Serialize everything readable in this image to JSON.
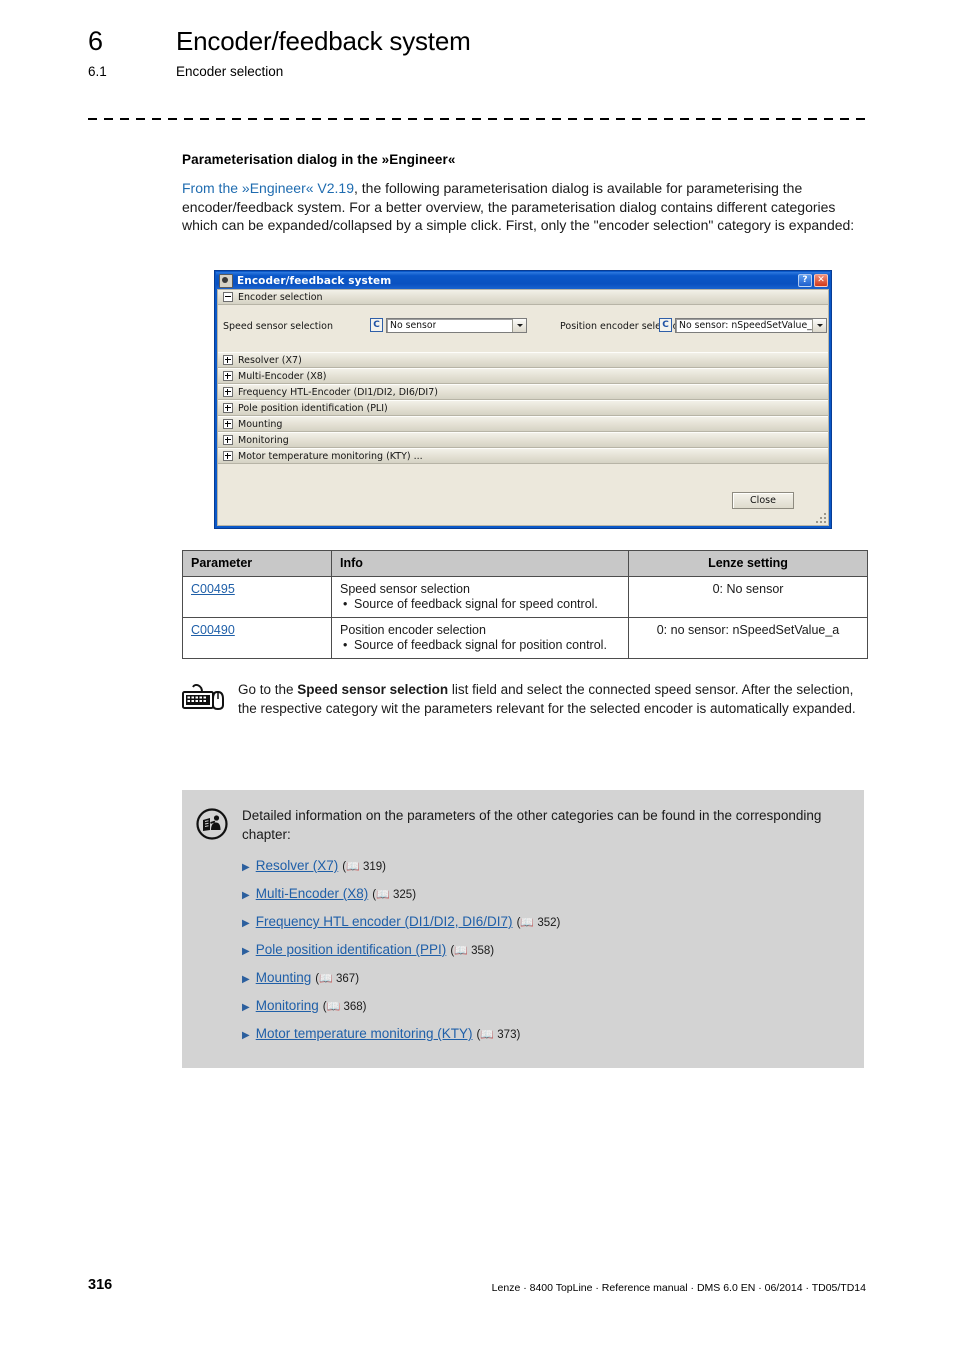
{
  "header": {
    "chapter_number": "6",
    "chapter_title": "Encoder/feedback system",
    "section_number": "6.1",
    "section_title": "Encoder selection"
  },
  "content": {
    "lead_title": "Parameterisation dialog in the »Engineer«",
    "intro_link": "From the »Engineer« V2.19",
    "intro_rest": ", the following parameterisation dialog is available for parameterising the encoder/feedback system. For a better overview, the parameterisation dialog contains different categories which can be expanded/collapsed by a simple click. First, only the \"encoder selection\" category is expanded:"
  },
  "dialog": {
    "title": "Encoder/feedback system",
    "app_icon": "app-icon",
    "help_button": "?",
    "close_button": "✕",
    "expanded_category": "Encoder selection",
    "speed_label": "Speed sensor selection",
    "speed_chip": "C",
    "speed_value": "No sensor",
    "position_label": "Position encoder selection",
    "position_chip": "C",
    "position_value": "No sensor: nSpeedSetValue_a",
    "categories": [
      "Resolver (X7)",
      "Multi-Encoder (X8)",
      "Frequency HTL-Encoder (DI1/DI2, DI6/DI7)",
      "Pole position identification (PLI)",
      "Mounting",
      "Monitoring",
      "Motor temperature monitoring (KTY) ..."
    ],
    "close_label": "Close"
  },
  "table": {
    "headers": [
      "Parameter",
      "Info",
      "Lenze setting"
    ],
    "rows": [
      {
        "parameter": "C00495",
        "info_title": "Speed sensor selection",
        "info_bullet": "Source of feedback signal for speed control.",
        "setting": "0: No sensor"
      },
      {
        "parameter": "C00490",
        "info_title": "Position encoder selection",
        "info_bullet": "Source of feedback signal for position control.",
        "setting": "0: no sensor: nSpeedSetValue_a"
      }
    ]
  },
  "note": {
    "icon": "keyboard-mouse-icon",
    "line1_pre": "Go to the ",
    "line1_bold": "Speed sensor selection",
    "line1_post": " list field and select the connected speed sensor.",
    "line2": "After the selection, the respective category wit the parameters relevant for the selected encoder is automatically expanded."
  },
  "infobox": {
    "icon": "read-manual-icon",
    "text": "Detailed information on the parameters of the other categories can be found in the corresponding chapter:",
    "links": [
      {
        "label": "Resolver (X7)",
        "page": "319"
      },
      {
        "label": "Multi-Encoder (X8)",
        "page": "325"
      },
      {
        "label": "Frequency HTL encoder (DI1/DI2, DI6/DI7)",
        "page": "352"
      },
      {
        "label": "Pole position identification (PPI)",
        "page": "358"
      },
      {
        "label": "Mounting",
        "page": "367"
      },
      {
        "label": "Monitoring",
        "page": "368"
      },
      {
        "label": "Motor temperature monitoring (KTY)",
        "page": "373"
      }
    ]
  },
  "footer": {
    "page_number": "316",
    "meta": "Lenze · 8400 TopLine · Reference manual · DMS 6.0 EN · 06/2014 · TD05/TD14"
  }
}
